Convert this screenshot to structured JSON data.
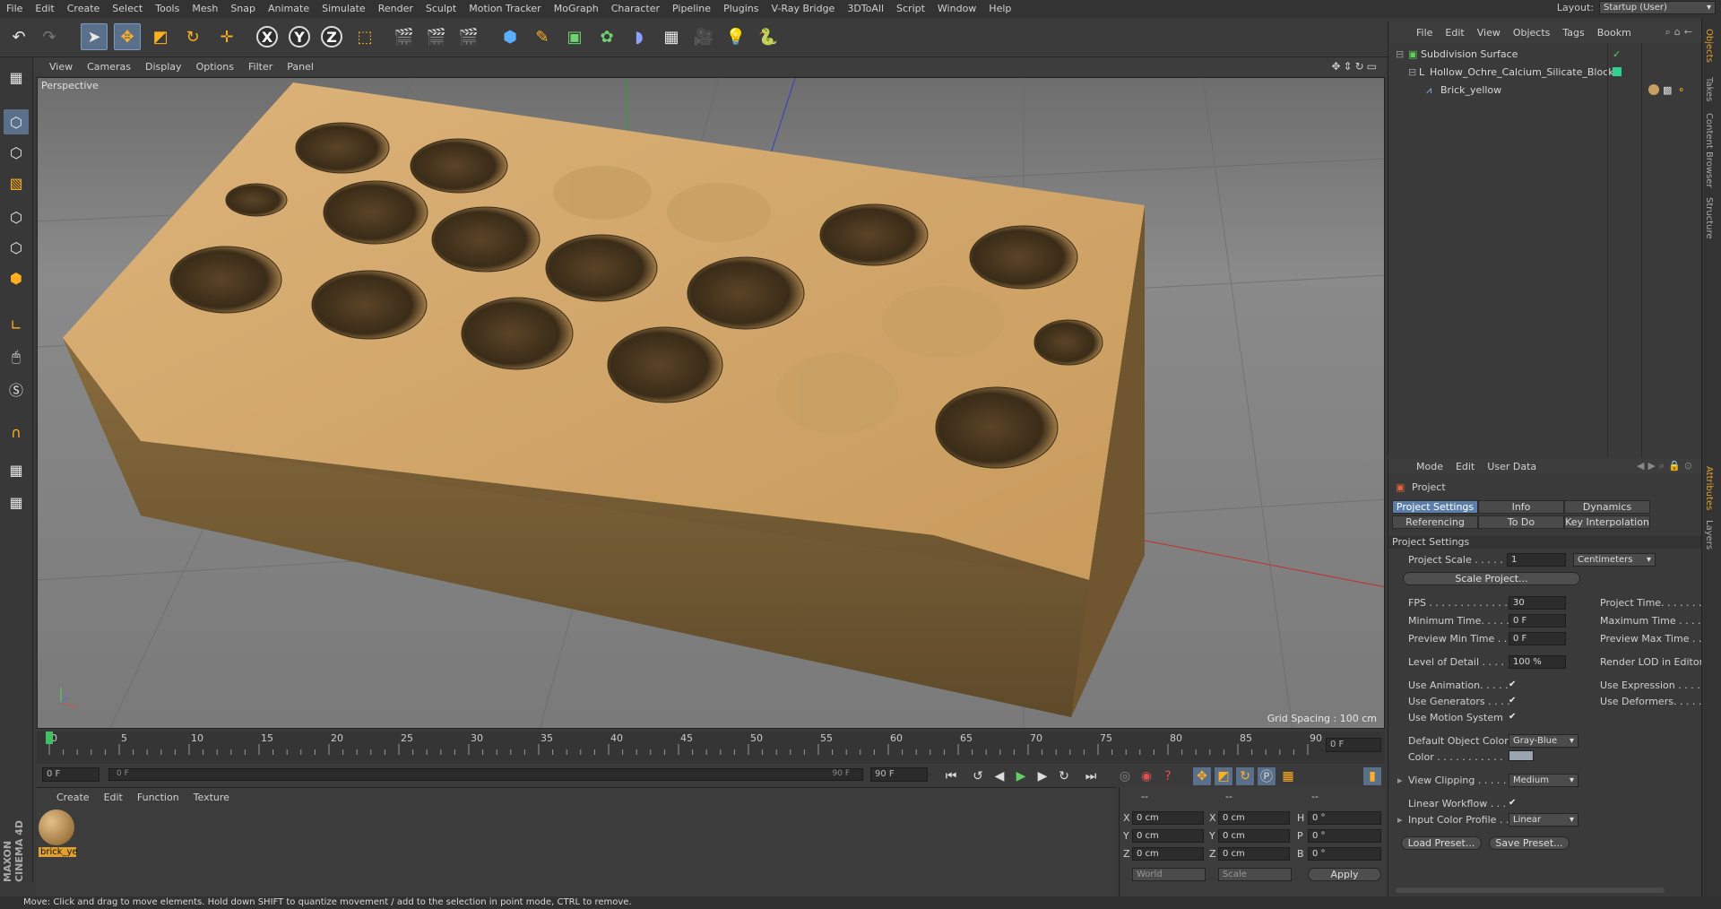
{
  "menu": [
    "File",
    "Edit",
    "Create",
    "Select",
    "Tools",
    "Mesh",
    "Snap",
    "Animate",
    "Simulate",
    "Render",
    "Sculpt",
    "Motion Tracker",
    "MoGraph",
    "Character",
    "Pipeline",
    "Plugins",
    "V-Ray Bridge",
    "3DToAll",
    "Script",
    "Window",
    "Help"
  ],
  "layout": {
    "label": "Layout:",
    "value": "Startup (User)"
  },
  "viewport": {
    "menu": [
      "View",
      "Cameras",
      "Display",
      "Options",
      "Filter",
      "Panel"
    ],
    "label": "Perspective",
    "grid_spacing": "Grid Spacing : 100 cm"
  },
  "timeline": {
    "ticks": [
      "0",
      "5",
      "10",
      "15",
      "20",
      "25",
      "30",
      "35",
      "40",
      "45",
      "50",
      "55",
      "60",
      "65",
      "70",
      "75",
      "80",
      "85",
      "90"
    ],
    "current_frame": "0 F",
    "start_field": "0 F",
    "range_start": "0 F",
    "range_end": "90 F",
    "end_field": "90 F"
  },
  "material_panel": {
    "menu": [
      "Create",
      "Edit",
      "Function",
      "Texture"
    ],
    "material_name": "brick_ye"
  },
  "coords": {
    "header_a": "--",
    "header_b": "--",
    "header_c": "--",
    "rows": [
      {
        "a": "X",
        "av": "0 cm",
        "b": "X",
        "bv": "0 cm",
        "c": "H",
        "cv": "0 °"
      },
      {
        "a": "Y",
        "av": "0 cm",
        "b": "Y",
        "bv": "0 cm",
        "c": "P",
        "cv": "0 °"
      },
      {
        "a": "Z",
        "av": "0 cm",
        "b": "Z",
        "bv": "0 cm",
        "c": "B",
        "cv": "0 °"
      }
    ],
    "world": "World",
    "scale": "Scale",
    "apply": "Apply"
  },
  "status": "Move: Click and drag to move elements. Hold down SHIFT to quantize movement / add to the selection in point mode, CTRL to remove.",
  "objects": {
    "menu": [
      "File",
      "Edit",
      "View",
      "Objects",
      "Tags",
      "Bookm"
    ],
    "items": [
      "Subdivision Surface",
      "Hollow_Ochre_Calcium_Silicate_Block",
      "Brick_yellow"
    ]
  },
  "attributes": {
    "menu": [
      "Mode",
      "Edit",
      "User Data"
    ],
    "title": "Project",
    "tabs": [
      "Project Settings",
      "Info",
      "Dynamics",
      "Referencing",
      "To Do",
      "Key Interpolation"
    ],
    "section": "Project Settings",
    "project_scale_label": "Project Scale . . . . . .",
    "project_scale": "1",
    "units": "Centimeters",
    "scale_project": "Scale Project...",
    "fps_label": "FPS . . . . . . . . . . . . . .",
    "fps": "30",
    "project_time_label": "Project Time. . . . . . . .",
    "min_time_label": "Minimum Time. . . . . .",
    "min_time": "0 F",
    "max_time_label": "Maximum Time . . . . .",
    "prev_min_label": "Preview Min Time . .",
    "prev_min": "0 F",
    "prev_max_label": "Preview Max Time . .",
    "lod_label": "Level of Detail . . . . .",
    "lod": "100 %",
    "render_lod_label": "Render LOD in Editor",
    "use_anim_label": "Use Animation. . . . .",
    "use_expr_label": "Use Expression . . . .",
    "use_gen_label": "Use Generators . . . .",
    "use_def_label": "Use Deformers. . . . .",
    "use_motion_label": "Use Motion System",
    "def_color_label": "Default Object Color",
    "def_color": "Gray-Blue",
    "color_label": "Color . . . . . . . . . . .",
    "view_clip_label": "View Clipping . . . . .",
    "view_clip": "Medium",
    "linear_wf_label": "Linear Workflow . . .",
    "input_profile_label": "Input Color Profile . .",
    "input_profile": "Linear",
    "load_preset": "Load Preset...",
    "save_preset": "Save Preset..."
  },
  "right_strip": [
    "Objects",
    "Takes",
    "Content Browser",
    "Structure",
    "Attributes",
    "Layers"
  ],
  "colors": {
    "brick": "#c9a063",
    "accent": "#5c7ea8"
  }
}
